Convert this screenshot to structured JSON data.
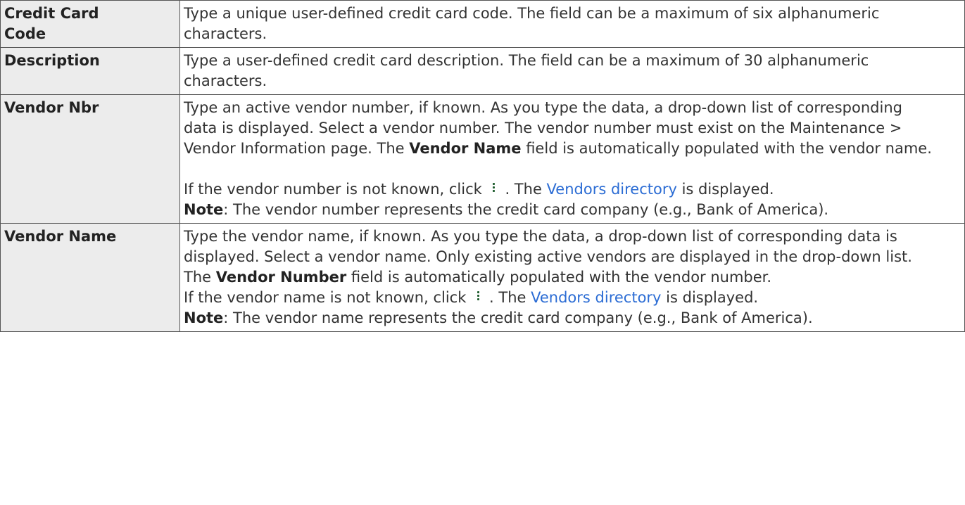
{
  "rows": [
    {
      "term_line1": "Credit Card",
      "term_line2": "Code",
      "text": "Type a unique user-defined credit card code. The field can be a maximum of six alphanumeric characters."
    },
    {
      "term": "Description",
      "text": "Type a user-defined credit card description. The field can be a maximum of 30 alphanumeric characters."
    },
    {
      "term": "Vendor Nbr",
      "p1_a": "Type an active vendor number, if known. As you type the data, a drop-down list of corresponding data is displayed. Select a vendor number. The vendor number must exist on the Maintenance > Vendor Information page. The ",
      "p1_bold": "Vendor Name",
      "p1_b": " field is automatically populated with the vendor name.",
      "p2_a": "If the vendor number is not known, click ",
      "p2_b": ". The ",
      "p2_link": "Vendors directory",
      "p2_c": " is displayed.",
      "note_label": "Note",
      "note_text": ": The vendor number represents the credit card company (e.g., Bank of America)."
    },
    {
      "term": "Vendor Name",
      "p1_a": "Type the vendor name, if known. As you type the data, a drop-down list of corresponding data is displayed. Select a vendor name. Only existing active vendors are displayed in the drop-down list. The ",
      "p1_bold": "Vendor Number",
      "p1_b": " field is automatically populated with the vendor number.",
      "p2_a": "If the vendor name is not known, click ",
      "p2_b": ". The ",
      "p2_link": "Vendors directory",
      "p2_c": " is displayed.",
      "note_label": "Note",
      "note_text": ": The vendor name represents the credit card company (e.g., Bank of America)."
    }
  ],
  "colors": {
    "link": "#2b6cd4",
    "icon": "#1d5c2c",
    "term_bg": "#ececec"
  }
}
